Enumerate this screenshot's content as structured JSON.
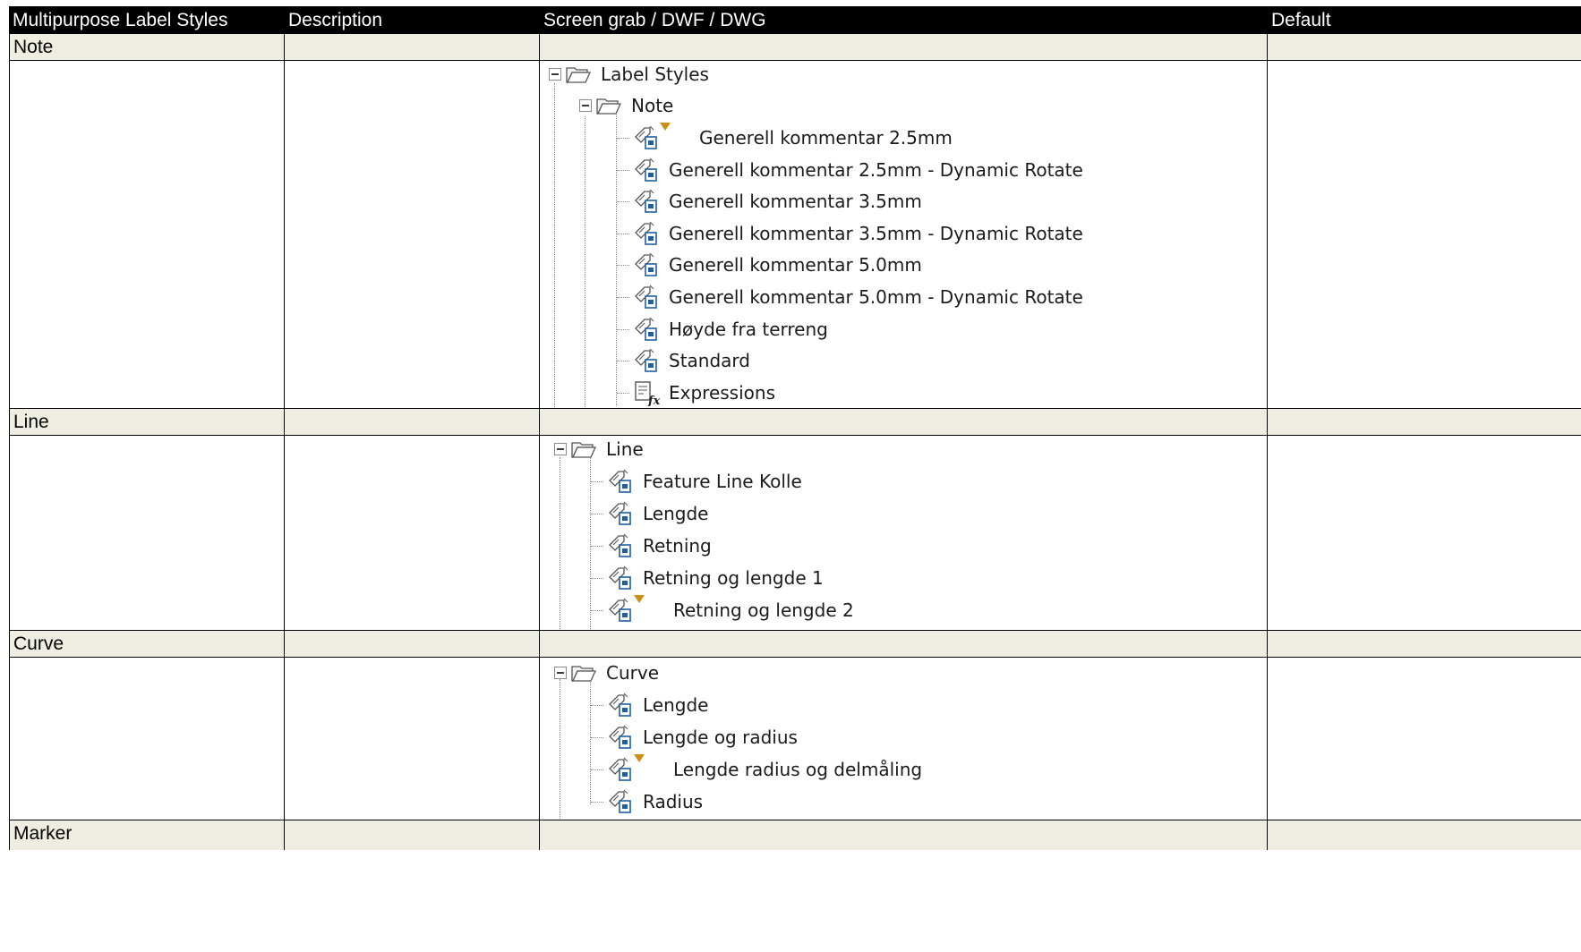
{
  "header": {
    "col1": "Multipurpose Label Styles",
    "col2": "Description",
    "col3": "Screen grab / DWF / DWG",
    "col4": "Default"
  },
  "sections": {
    "note": {
      "title": "Note",
      "root": "Label Styles",
      "folder": "Note",
      "items": [
        "Generell kommentar 2.5mm",
        "Generell kommentar 2.5mm - Dynamic Rotate",
        "Generell kommentar 3.5mm",
        "Generell kommentar 3.5mm - Dynamic Rotate",
        "Generell kommentar 5.0mm",
        "Generell kommentar 5.0mm - Dynamic Rotate",
        "Høyde fra terreng",
        "Standard",
        "Expressions"
      ]
    },
    "line": {
      "title": "Line",
      "folder": "Line",
      "items": [
        "Feature Line Kolle",
        "Lengde",
        "Retning",
        "Retning og lengde 1",
        "Retning og lengde 2"
      ]
    },
    "curve": {
      "title": "Curve",
      "folder": "Curve",
      "items": [
        "Lengde",
        "Lengde og radius",
        "Lengde radius og delmåling",
        "Radius"
      ]
    },
    "marker": {
      "title": "Marker"
    }
  },
  "icons": {
    "style": "label-style-icon",
    "expressions": "expressions-icon",
    "folder": "open-folder-icon",
    "flag": "default-flag-icon"
  },
  "colors": {
    "header_bg": "#000000",
    "section_bg": "#efece2",
    "flag": "#c89016"
  }
}
